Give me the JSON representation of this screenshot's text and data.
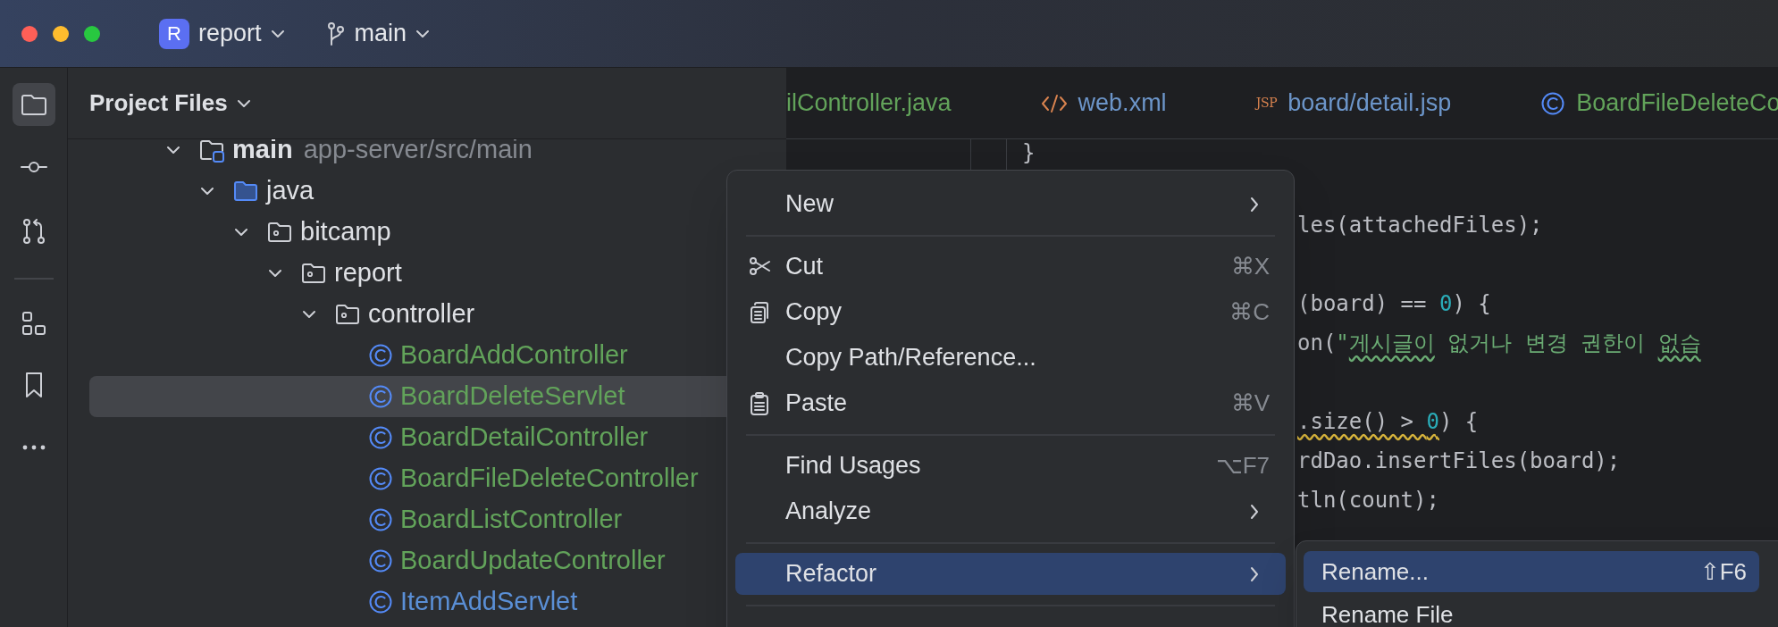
{
  "title_bar": {
    "project_badge": "R",
    "project": "report",
    "branch": "main"
  },
  "tool_strip": [
    {
      "kind": "folder",
      "selected": true
    },
    {
      "kind": "commit",
      "selected": false
    },
    {
      "kind": "pull-requests",
      "selected": false
    },
    {
      "kind": "separator"
    },
    {
      "kind": "structure",
      "selected": false
    },
    {
      "kind": "bookmarks",
      "selected": false
    },
    {
      "kind": "more",
      "selected": false
    }
  ],
  "project_panel": {
    "title": "Project Files",
    "tree": [
      {
        "label": "main",
        "detail": "app-server/src/main",
        "kind": "module",
        "expanded": true,
        "selected": false,
        "children": [
          {
            "label": "java",
            "kind": "source-folder",
            "expanded": true,
            "selected": false,
            "children": [
              {
                "label": "bitcamp",
                "kind": "package",
                "expanded": true,
                "selected": false,
                "children": [
                  {
                    "label": "report",
                    "kind": "package",
                    "expanded": true,
                    "selected": false,
                    "children": [
                      {
                        "label": "controller",
                        "kind": "package",
                        "expanded": true,
                        "selected": false,
                        "children": [
                          {
                            "label": "BoardAddController",
                            "kind": "class",
                            "color": "#62a35a",
                            "selected": false
                          },
                          {
                            "label": "BoardDeleteServlet",
                            "kind": "class",
                            "color": "#62a35a",
                            "selected": true
                          },
                          {
                            "label": "BoardDetailController",
                            "kind": "class",
                            "color": "#62a35a",
                            "selected": false
                          },
                          {
                            "label": "BoardFileDeleteController",
                            "kind": "class",
                            "color": "#62a35a",
                            "selected": false
                          },
                          {
                            "label": "BoardListController",
                            "kind": "class",
                            "color": "#62a35a",
                            "selected": false
                          },
                          {
                            "label": "BoardUpdateController",
                            "kind": "class",
                            "color": "#62a35a",
                            "selected": false
                          },
                          {
                            "label": "ItemAddServlet",
                            "kind": "class",
                            "color": "#5a8fd6",
                            "selected": false
                          }
                        ]
                      }
                    ]
                  }
                ]
              }
            ]
          }
        ]
      }
    ]
  },
  "tabs": [
    {
      "label": "ilController.java",
      "kind": "plain",
      "color": "#62a35a"
    },
    {
      "label": "web.xml",
      "kind": "xml",
      "color": "#6c95c9"
    },
    {
      "label": "board/detail.jsp",
      "kind": "jsp",
      "icon_text": "JSP",
      "color": "#6c95c9"
    },
    {
      "label": "BoardFileDeleteCo",
      "kind": "class",
      "color": "#62a35a"
    }
  ],
  "editor": {
    "lines": [
      {
        "kind": "outer",
        "segments": [
          {
            "text": "}",
            "kind": "plain"
          }
        ]
      },
      {
        "kind": "blank"
      },
      {
        "kind": "code",
        "segments": [
          {
            "text": "les(attachedFiles);",
            "kind": "plain"
          }
        ]
      },
      {
        "kind": "blank"
      },
      {
        "kind": "code",
        "segments": [
          {
            "text": "(board) == ",
            "kind": "plain"
          },
          {
            "text": "0",
            "kind": "number"
          },
          {
            "text": ") {",
            "kind": "plain"
          }
        ]
      },
      {
        "kind": "code",
        "segments": [
          {
            "text": "on(",
            "kind": "plain"
          },
          {
            "text": "\"",
            "kind": "string"
          },
          {
            "text": "게시글이",
            "kind": "string-typo"
          },
          {
            "text": " 없거나 변경 권한이 ",
            "kind": "string"
          },
          {
            "text": "없습",
            "kind": "string-typo"
          }
        ]
      },
      {
        "kind": "blank"
      },
      {
        "kind": "code",
        "segments": [
          {
            "text": ".size() > ",
            "kind": "plain-warning"
          },
          {
            "text": "0",
            "kind": "number-warning"
          },
          {
            "text": ") {",
            "kind": "plain"
          }
        ]
      },
      {
        "kind": "code",
        "segments": [
          {
            "text": "rdDao.insertFiles(board);",
            "kind": "plain"
          }
        ]
      },
      {
        "kind": "code",
        "segments": [
          {
            "text": "tln(count);",
            "kind": "plain"
          }
        ]
      }
    ]
  },
  "context_menu": {
    "groups": [
      [
        {
          "label": "New",
          "submenu": true,
          "selected": false
        }
      ],
      [
        {
          "label": "Cut",
          "kind": "cut",
          "shortcut": "⌘X",
          "selected": false
        },
        {
          "label": "Copy",
          "kind": "copy",
          "shortcut": "⌘C",
          "selected": false
        },
        {
          "label": "Copy Path/Reference...",
          "selected": false
        },
        {
          "label": "Paste",
          "kind": "paste",
          "shortcut": "⌘V",
          "selected": false
        }
      ],
      [
        {
          "label": "Find Usages",
          "shortcut": "⌥F7",
          "selected": false
        },
        {
          "label": "Analyze",
          "submenu": true,
          "selected": false
        }
      ],
      [
        {
          "label": "Refactor",
          "submenu": true,
          "selected": true
        }
      ]
    ]
  },
  "submenu": {
    "items": [
      {
        "label": "Rename...",
        "shortcut": "⇧F6",
        "selected": true
      },
      {
        "label": "Rename File",
        "selected": false
      }
    ]
  }
}
